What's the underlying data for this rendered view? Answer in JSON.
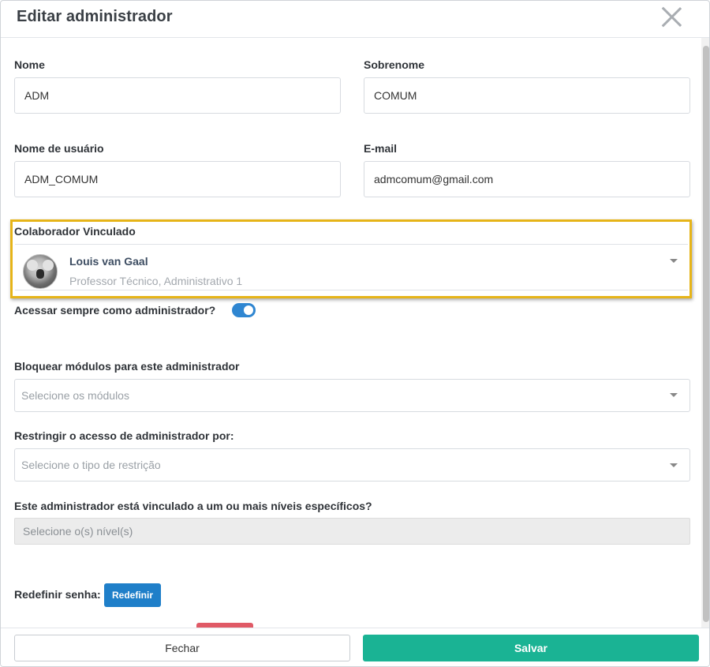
{
  "modal": {
    "title": "Editar administrador"
  },
  "form": {
    "nome": {
      "label": "Nome",
      "value": "ADM"
    },
    "sobrenome": {
      "label": "Sobrenome",
      "value": "COMUM"
    },
    "usuario": {
      "label": "Nome de usuário",
      "value": "ADM_COMUM"
    },
    "email": {
      "label": "E-mail",
      "value": "admcomum@gmail.com"
    },
    "colaborador": {
      "label": "Colaborador Vinculado",
      "name": "Louis van Gaal",
      "role": "Professor Técnico, Administrativo 1"
    },
    "acessar_sempre": {
      "label": "Acessar sempre como administrador?",
      "enabled": true
    },
    "bloquear": {
      "label": "Bloquear módulos para este administrador",
      "placeholder": "Selecione os módulos"
    },
    "restringir": {
      "label": "Restringir o acesso de administrador por:",
      "placeholder": "Selecione o tipo de restrição"
    },
    "niveis": {
      "label": "Este administrador está vinculado a um ou mais níveis específicos?",
      "placeholder": "Selecione o(s) nível(s)"
    },
    "senha": {
      "label": "Redefinir senha:",
      "button": "Redefinir"
    }
  },
  "footer": {
    "close_label": "Fechar",
    "save_label": "Salvar"
  },
  "colors": {
    "highlight": "#e6b418",
    "primary": "#1f7fc9",
    "save": "#1ab394"
  }
}
